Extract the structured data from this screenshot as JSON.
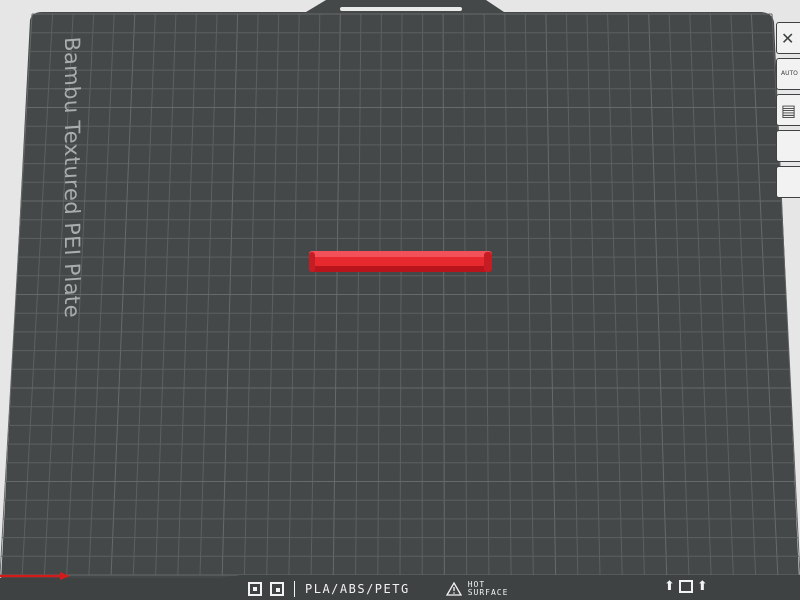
{
  "plate": {
    "label": "Bambu Textured PEI Plate",
    "colors": {
      "surface": "#444848",
      "grid": "#5d6161",
      "grid_major": "#6a6e6e",
      "border": "#e9ebeb",
      "object": "#e8282f",
      "axis_x": "#d21b1b",
      "background": "#e6e6e6"
    }
  },
  "toolbar": {
    "buttons": [
      {
        "icon": "close-icon",
        "glyph": "✕"
      },
      {
        "icon": "auto-orient-icon",
        "text": "AUTO"
      },
      {
        "icon": "layout-icon",
        "glyph": "▤"
      },
      {
        "icon": "split-icon",
        "glyph": ""
      },
      {
        "icon": "frame-icon",
        "glyph": ""
      }
    ]
  },
  "status_bar": {
    "material": "PLA/ABS/PETG",
    "hot_line1": "HOT",
    "hot_line2": "SURFACE",
    "warning_icon": "warning-triangle-icon"
  }
}
